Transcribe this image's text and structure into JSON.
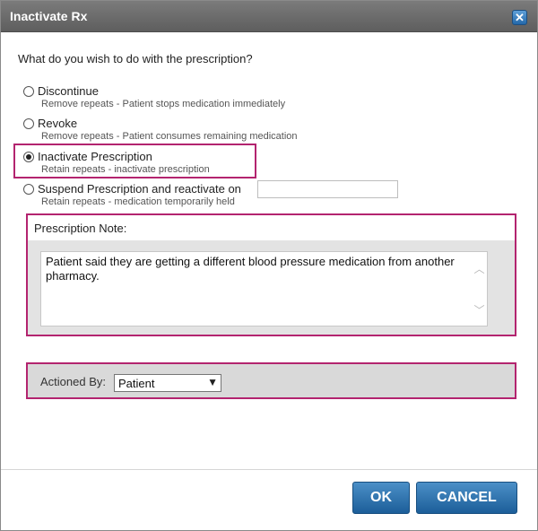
{
  "dialog": {
    "title": "Inactivate Rx",
    "close_icon": "close-icon",
    "question": "What do you wish to do with the prescription?"
  },
  "options": [
    {
      "label": "Discontinue",
      "sub": "Remove repeats - Patient stops medication immediately",
      "selected": false
    },
    {
      "label": "Revoke",
      "sub": "Remove repeats - Patient consumes remaining medication",
      "selected": false
    },
    {
      "label": "Inactivate Prescription",
      "sub": "Retain repeats - inactivate prescription",
      "selected": true
    },
    {
      "label": "Suspend Prescription and reactivate on",
      "sub": "Retain repeats - medication temporarily held",
      "selected": false
    }
  ],
  "suspend_date_value": "",
  "note": {
    "label": "Prescription Note:",
    "text": "Patient said they are getting a different blood pressure medication from another pharmacy."
  },
  "actioned_by": {
    "label": "Actioned By:",
    "selected": "Patient"
  },
  "buttons": {
    "ok": "OK",
    "cancel": "CANCEL"
  },
  "colors": {
    "highlight": "#b3246f",
    "button": "#2a6fae",
    "titlebar": "#6b6b6b"
  }
}
